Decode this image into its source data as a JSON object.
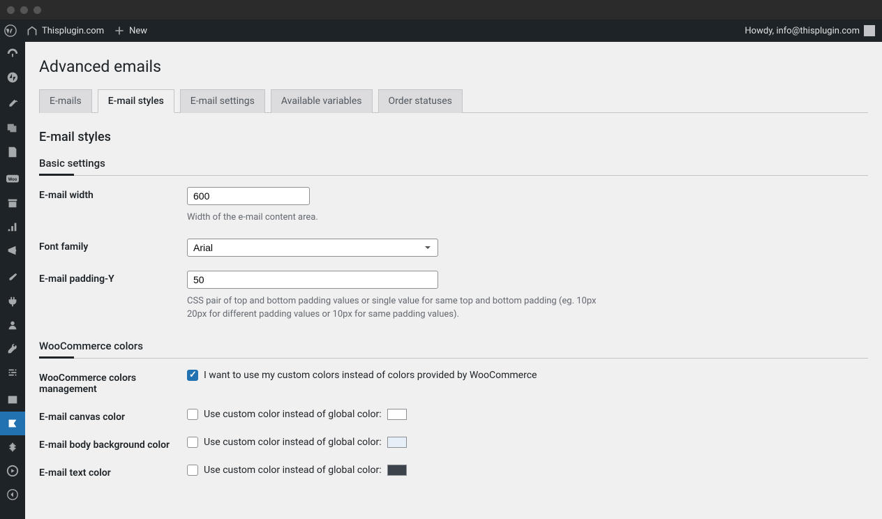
{
  "adminbar": {
    "site": "Thisplugin.com",
    "new": "New",
    "howdy": "Howdy, info@thisplugin.com"
  },
  "page": {
    "title": "Advanced emails",
    "tabs": [
      "E-mails",
      "E-mail styles",
      "E-mail settings",
      "Available variables",
      "Order statuses"
    ],
    "h2": "E-mail styles"
  },
  "basic": {
    "heading": "Basic settings",
    "width_label": "E-mail width",
    "width_value": "600",
    "width_desc": "Width of the e-mail content area.",
    "font_label": "Font family",
    "font_value": "Arial",
    "pad_label": "E-mail padding-Y",
    "pad_value": "50",
    "pad_desc": "CSS pair of top and bottom padding values or single value for same top and bottom padding (eg. 10px 20px for different padding values or 10px for same padding values)."
  },
  "woo": {
    "heading": "WooCommerce colors",
    "mgmt_label": "WooCommerce colors management",
    "mgmt_text": "I want to use my custom colors instead of colors provided by WooCommerce",
    "canvas_label": "E-mail canvas color",
    "body_label": "E-mail body background color",
    "text_label": "E-mail text color",
    "cb_text": "Use custom color instead of global color:",
    "canvas_color": "#ffffff",
    "body_color": "#e6eef7",
    "text_color": "#3c434a"
  }
}
